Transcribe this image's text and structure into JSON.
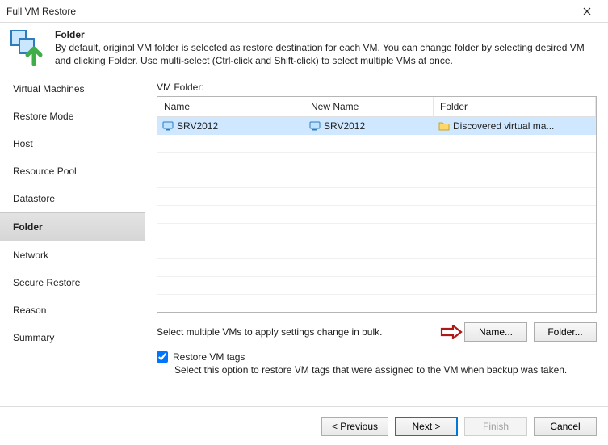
{
  "window": {
    "title": "Full VM Restore",
    "close": "✕"
  },
  "header": {
    "title": "Folder",
    "desc": "By default, original VM folder is selected as restore destination for each VM. You can change folder by selecting desired VM and clicking Folder. Use multi-select (Ctrl-click and Shift-click) to select multiple VMs at once."
  },
  "nav": {
    "items": [
      "Virtual Machines",
      "Restore Mode",
      "Host",
      "Resource Pool",
      "Datastore",
      "Folder",
      "Network",
      "Secure Restore",
      "Reason",
      "Summary"
    ],
    "active_index": 5
  },
  "grid": {
    "label": "VM Folder:",
    "cols": {
      "name": "Name",
      "newname": "New Name",
      "folder": "Folder"
    },
    "rows": [
      {
        "name": "SRV2012",
        "newname": "SRV2012",
        "folder": "Discovered virtual ma..."
      }
    ]
  },
  "bulk": {
    "hint": "Select multiple VMs to apply settings change in bulk.",
    "name_btn": "Name...",
    "folder_btn": "Folder..."
  },
  "tags": {
    "label": "Restore VM tags",
    "desc": "Select this option to restore VM tags that were assigned to the VM when backup was taken.",
    "checked": true
  },
  "footer": {
    "prev": "< Previous",
    "next": "Next >",
    "finish": "Finish",
    "cancel": "Cancel"
  }
}
